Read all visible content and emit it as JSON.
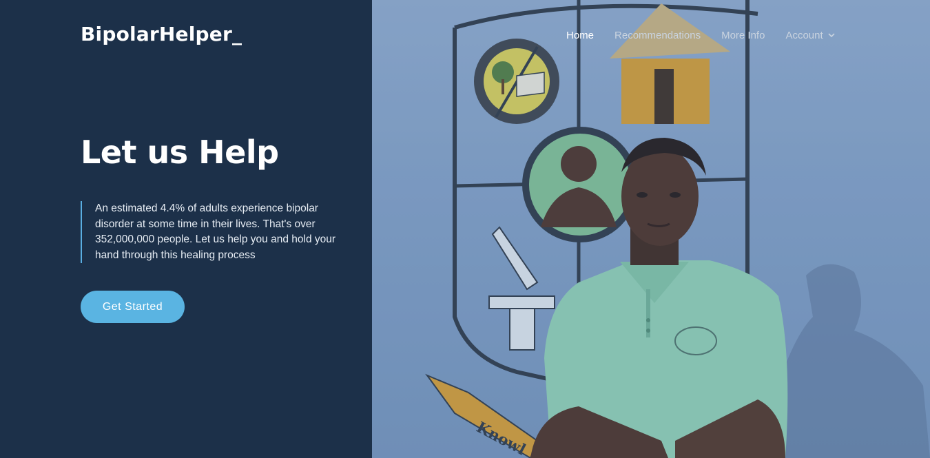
{
  "brand": {
    "logo_text": "BipolarHelper_"
  },
  "nav": {
    "items": [
      {
        "label": "Home",
        "active": true
      },
      {
        "label": "Recommendations",
        "active": false
      },
      {
        "label": "More Info",
        "active": false
      },
      {
        "label": "Account",
        "active": false,
        "dropdown": true
      }
    ]
  },
  "hero": {
    "title": "Let us Help",
    "blurb": "An estimated 4.4% of adults experience bipolar disorder at some time in their lives. That's over 352,000,000 people. Let us help you and hold your hand through this healing process",
    "cta_label": "Get Started",
    "image_caption_text": "Knowl"
  },
  "colors": {
    "panel": "#1c3049",
    "accent": "#5ab4e2",
    "nav_inactive": "#c9d3df"
  }
}
